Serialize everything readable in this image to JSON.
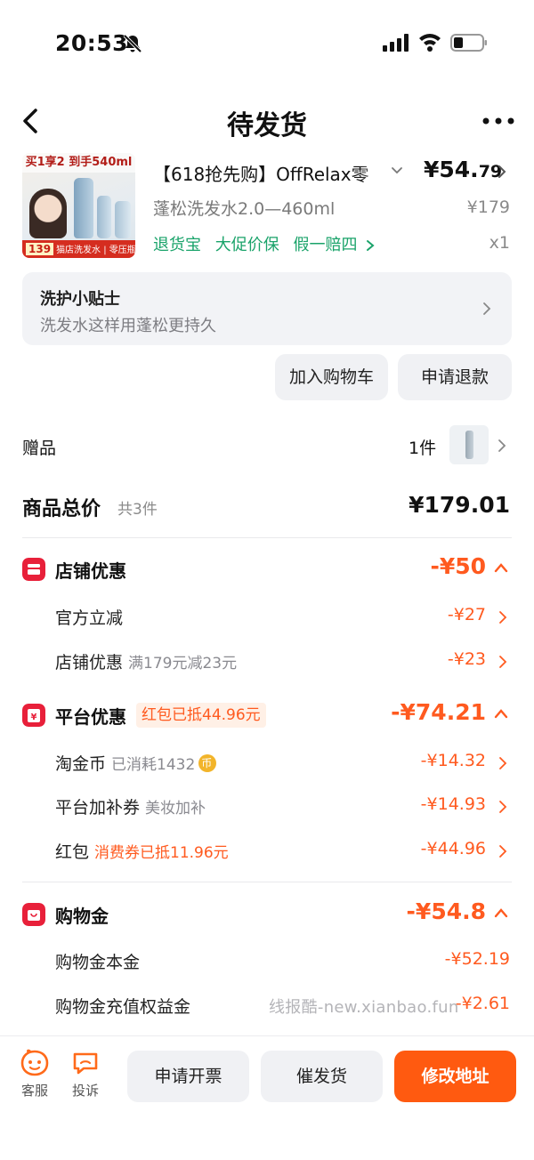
{
  "status": {
    "time": "20:53"
  },
  "nav": {
    "title": "待发货"
  },
  "product": {
    "image_promo_top": "买1享2 到手540ml",
    "image_promo_bottom_price": "139",
    "image_promo_bottom_text": "猫店洗发水 | 零压瓶 | 蓬松",
    "title": "【618抢先购】OffRelax零",
    "price_main": "¥54.",
    "price_decimal": "79",
    "spec": "蓬松洗发水2.0—460ml",
    "original_price": "¥179",
    "tags": [
      "退货宝",
      "大促价保",
      "假一赔四"
    ],
    "quantity": "x1"
  },
  "tip": {
    "title": "洗护小贴士",
    "subtitle": "洗发水这样用蓬松更持久"
  },
  "actions": {
    "add_to_cart": "加入购物车",
    "refund": "申请退款"
  },
  "gift": {
    "label": "赠品",
    "count": "1件"
  },
  "total": {
    "label": "商品总价",
    "count": "共3件",
    "value": "¥179.01"
  },
  "shop_discount": {
    "title": "店铺优惠",
    "amount": "-¥50",
    "items": [
      {
        "label": "官方立减",
        "note": "",
        "amount": "-¥27"
      },
      {
        "label": "店铺优惠",
        "note": "满179元减23元",
        "amount": "-¥23"
      }
    ]
  },
  "platform_discount": {
    "title": "平台优惠",
    "badge": "红包已抵44.96元",
    "amount": "-¥74.21",
    "items": [
      {
        "label": "淘金币",
        "note": "已消耗1432",
        "amount": "-¥14.32"
      },
      {
        "label": "平台加补券",
        "note": "美妆加补",
        "amount": "-¥14.93"
      },
      {
        "label": "红包",
        "note": "消费券已抵11.96元",
        "amount": "-¥44.96"
      }
    ]
  },
  "shopping_credit": {
    "title": "购物金",
    "amount": "-¥54.8",
    "items": [
      {
        "label": "购物金本金",
        "amount": "-¥52.19"
      },
      {
        "label": "购物金充值权益金",
        "amount": "-¥2.61"
      }
    ]
  },
  "watermark": "线报酷-new.xianbao.fun",
  "bottom_bar": {
    "service_label": "客服",
    "complain_label": "投诉",
    "invoice": "申请开票",
    "remind": "催发货",
    "address": "修改地址"
  },
  "colors": {
    "accent": "#ff5a10",
    "discount": "#ff5a1f",
    "green": "#1aa36a",
    "badge_red": "#e8203a"
  }
}
